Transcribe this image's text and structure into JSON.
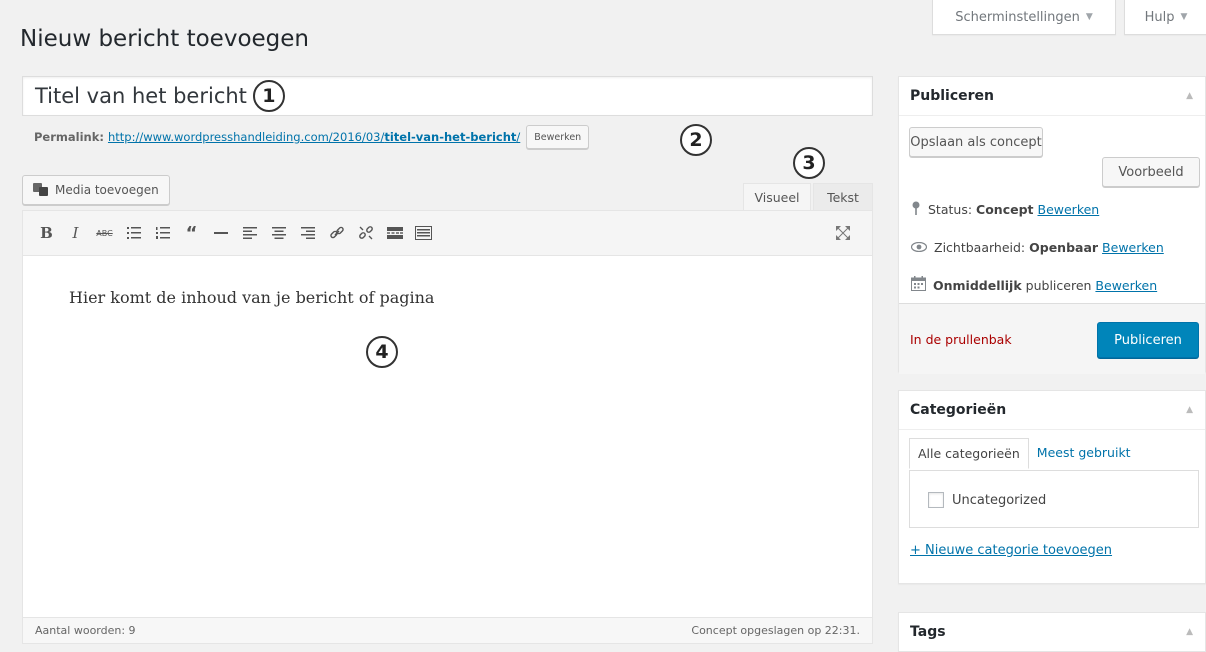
{
  "header": {
    "screen_options": "Scherminstellingen",
    "help": "Hulp",
    "page_title": "Nieuw bericht toevoegen"
  },
  "editor": {
    "title_value": "Titel van het bericht",
    "permalink_label": "Permalink:",
    "permalink_base": "http://www.wordpresshandleiding.com/2016/03/",
    "permalink_slug": "titel-van-het-bericht",
    "permalink_trailing": "/",
    "permalink_edit": "Bewerken",
    "media_button": "Media toevoegen",
    "tab_visual": "Visueel",
    "tab_text": "Tekst",
    "toolbar_icons": [
      "bold-icon",
      "italic-icon",
      "strikethrough-icon",
      "bullet-list-icon",
      "numbered-list-icon",
      "blockquote-icon",
      "horizontal-line-icon",
      "align-left-icon",
      "align-center-icon",
      "align-right-icon",
      "insert-link-icon",
      "remove-link-icon",
      "read-more-icon",
      "toolbar-toggle-icon",
      "fullscreen-icon"
    ],
    "content_text": "Hier komt de inhoud van je bericht of pagina",
    "word_count": "Aantal woorden: 9",
    "saved_status": "Concept opgeslagen op 22:31."
  },
  "markers": {
    "m1": "1",
    "m2": "2",
    "m3": "3",
    "m4": "4"
  },
  "publish": {
    "title": "Publiceren",
    "save_draft": "Opslaan als concept",
    "preview": "Voorbeeld",
    "status_label": "Status:",
    "status_value": "Concept",
    "visibility_label": "Zichtbaarheid:",
    "visibility_value": "Openbaar",
    "schedule_value": "Onmiddellijk",
    "schedule_label": "publiceren",
    "edit_link": "Bewerken",
    "trash": "In de prullenbak",
    "publish_button": "Publiceren"
  },
  "categories": {
    "title": "Categorieën",
    "tab_all": "Alle categorieën",
    "tab_popular": "Meest gebruikt",
    "items": [
      "Uncategorized"
    ],
    "add_new": "+ Nieuwe categorie toevoegen"
  },
  "tags": {
    "title": "Tags"
  },
  "colors": {
    "accent": "#0073aa",
    "publish_button": "#0085ba",
    "trash": "#aa0000",
    "background": "#f1f1f1"
  }
}
